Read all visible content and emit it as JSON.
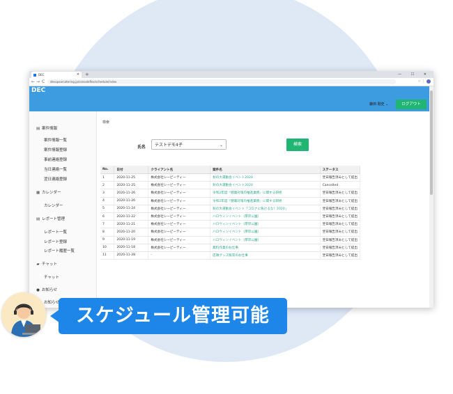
{
  "browser": {
    "tab_title": "DEC",
    "tab_close": "×",
    "new_tab": "+",
    "window_controls": "— ☐ ✕",
    "nav_back": "←",
    "nav_forward": "→",
    "nav_reload": "C",
    "url": "devopsorcatering.jp/consoleflex/schedule/index",
    "addr_icons": "☆ ⋮"
  },
  "header": {
    "logo": "DEC",
    "user": "鎌田 剛史 ⌄",
    "logout_label": "ログアウト"
  },
  "sidebar": {
    "sections": [
      {
        "icon": "▤",
        "label": "案件情報",
        "items": [
          "案件情報一覧",
          "案件情報登録",
          "事前連絡登録",
          "当日連絡一覧",
          "翌日連絡登録"
        ]
      },
      {
        "icon": "▦",
        "label": "カレンダー",
        "items": [
          "カレンダー"
        ]
      },
      {
        "icon": "▤",
        "label": "レポート管理",
        "items": [
          "レポート一覧",
          "レポート登録",
          "レポート履歴一覧"
        ]
      },
      {
        "icon": "▰",
        "label": "チャット",
        "items": [
          "チャット"
        ]
      },
      {
        "icon": "●",
        "label": "お知らせ",
        "items": [
          "お知らせ"
        ]
      }
    ]
  },
  "main": {
    "breadcrumb": "検索",
    "name_label": "氏名",
    "name_select_value": "テストデモ4子",
    "search_label": "検索",
    "columns": [
      "No.",
      "日付",
      "クライアント名",
      "案件名",
      "ステータス"
    ],
    "rows": [
      [
        "1",
        "2020-11-25",
        "株式会社シーピーティー",
        "秋の大運動会イベント2020",
        "翌日報告済みとして提出"
      ],
      [
        "2",
        "2020-11-25",
        "株式会社シーピーティー",
        "秋の大運動会イベント2020",
        "Cancelled"
      ],
      [
        "3",
        "2020-11-26",
        "株式会社シーピーティー",
        "令和2年度『健康対策の推進業務』に関する研修",
        "翌日報告済みとして提出"
      ],
      [
        "4",
        "2020-11-26",
        "株式会社シーピーティー",
        "令和2年度『健康対策の推進業務』に関する研修",
        "翌日報告済みとして提出"
      ],
      [
        "5",
        "2020-11-24",
        "株式会社シーピーティー",
        "秋の大運動会イベント「コロナに負けるな！2020」",
        "翌日報告済みとして提出"
      ],
      [
        "6",
        "2020-11-22",
        "株式会社シーピーティー",
        "ハロウィンイベント（厚岸公園）",
        "翌日報告済みとして提出"
      ],
      [
        "7",
        "2020-11-21",
        "株式会社シーピーティー",
        "ハロウィンイベント（厚岸公園）",
        "翌日報告済みとして提出"
      ],
      [
        "8",
        "2020-11-20",
        "株式会社シーピーティー",
        "ハロウィンイベント（厚岸公園）",
        "翌日報告済みとして提出"
      ],
      [
        "9",
        "2020-11-19",
        "株式会社シーピーティー",
        "ハロウィンイベント（厚岸公園）",
        "翌日報告済みとして提出"
      ],
      [
        "10",
        "2020-11-18",
        "株式会社シーピーティー",
        "無料作業のお仕事",
        "翌日報告済みとして提出"
      ],
      [
        "11",
        "2020-11-28",
        "-",
        "店頭グッズ販売のお仕事",
        "翌日報告済みとして提出"
      ]
    ]
  },
  "banner": {
    "text": "スケジュール管理可能"
  },
  "colors": {
    "header_blue": "#3d9be0",
    "green": "#21b573",
    "banner_blue": "#1d86e8",
    "bg_circle": "#dfe9f6"
  }
}
